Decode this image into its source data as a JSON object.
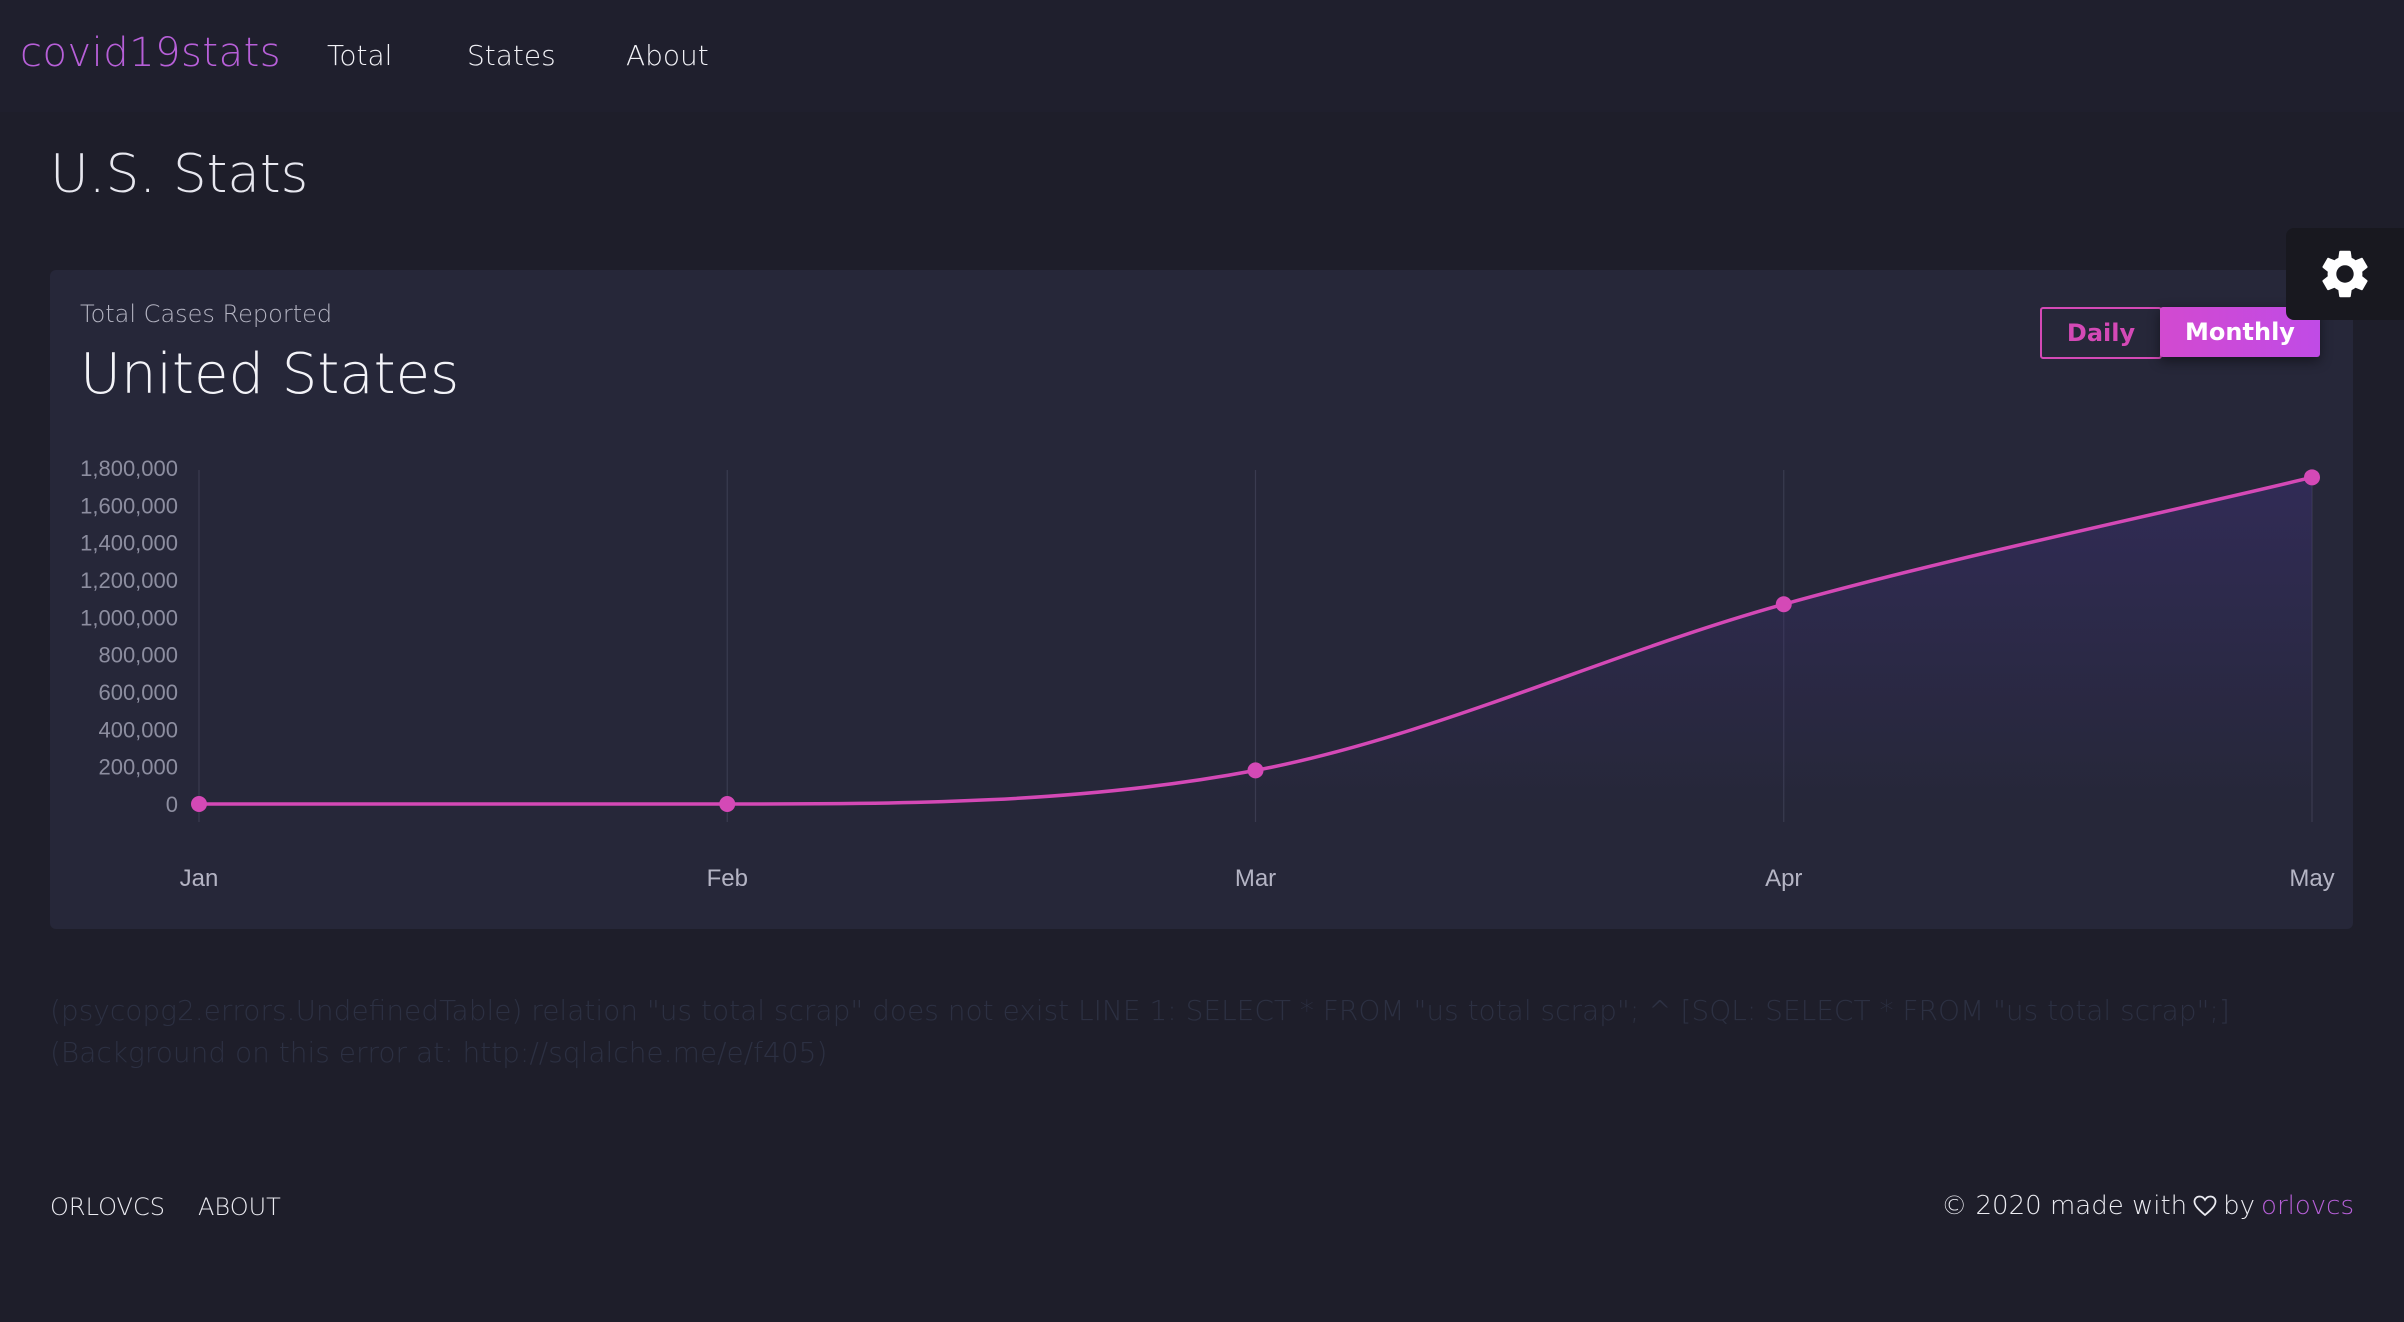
{
  "navbar": {
    "brand": "covid19stats",
    "links": [
      "Total",
      "States",
      "About"
    ]
  },
  "page": {
    "title": "U.S. Stats"
  },
  "card": {
    "subtitle": "Total Cases Reported",
    "title": "United States",
    "toggle": {
      "daily": "Daily",
      "monthly": "Monthly",
      "selected": "Monthly"
    }
  },
  "chart_data": {
    "type": "line",
    "categories": [
      "Jan",
      "Feb",
      "Mar",
      "Apr",
      "May"
    ],
    "series": [
      {
        "values": [
          0,
          0,
          180000,
          1070000,
          1750000
        ],
        "color": "#d449b6"
      }
    ],
    "ylim": [
      0,
      1800000
    ],
    "yticks": [
      "0",
      "200,000",
      "400,000",
      "600,000",
      "800,000",
      "1,000,000",
      "1,200,000",
      "1,400,000",
      "1,600,000",
      "1,800,000"
    ],
    "ytick_values": [
      0,
      200000,
      400000,
      600000,
      800000,
      1000000,
      1200000,
      1400000,
      1600000,
      1800000
    ],
    "grid": "vertical",
    "area_fill": true
  },
  "error_message": "(psycopg2.errors.UndefinedTable) relation \"us total scrap\" does not exist LINE 1: SELECT * FROM \"us total scrap\"; ^ [SQL: SELECT * FROM \"us total scrap\";] (Background on this error at: http://sqlalche.me/e/f405)",
  "footer": {
    "links": [
      "ORLOVCS",
      "ABOUT"
    ],
    "copyright": "© 2020 made with",
    "by": "by",
    "author": "orlovcs"
  },
  "colors": {
    "accent": "#d449b6",
    "brand": "#b75fd8",
    "background": "#1e1e2a",
    "card": "#262739"
  },
  "icons": {
    "settings": "gear-icon",
    "heart": "heart-icon"
  }
}
